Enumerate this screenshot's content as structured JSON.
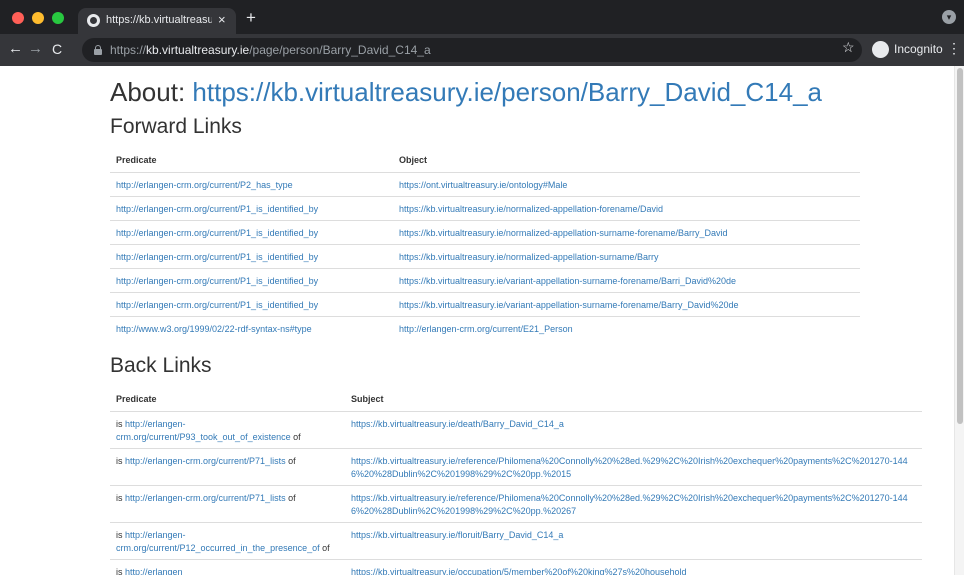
{
  "browser": {
    "tab_title": "https://kb.virtualtreasury.ie/pe",
    "tab_close": "×",
    "new_tab": "+",
    "url_prefix": "https://",
    "url_host": "kb.virtualtreasury.ie",
    "url_path": "/page/person/Barry_David_C14_a",
    "profile_label": "Incognito",
    "back_icon": "←",
    "forward_icon": "→",
    "reload_icon": "C",
    "star_icon": "☆",
    "menu_icon": "⋮"
  },
  "page": {
    "title_prefix": "About: ",
    "title_link": "https://kb.virtualtreasury.ie/person/Barry_David_C14_a",
    "forward_heading": "Forward Links",
    "forward_columns": [
      "Predicate",
      "Object"
    ],
    "forward_rows": [
      {
        "predicate": "http://erlangen-crm.org/current/P2_has_type",
        "object": "https://ont.virtualtreasury.ie/ontology#Male"
      },
      {
        "predicate": "http://erlangen-crm.org/current/P1_is_identified_by",
        "object": "https://kb.virtualtreasury.ie/normalized-appellation-forename/David"
      },
      {
        "predicate": "http://erlangen-crm.org/current/P1_is_identified_by",
        "object": "https://kb.virtualtreasury.ie/normalized-appellation-surname-forename/Barry_David"
      },
      {
        "predicate": "http://erlangen-crm.org/current/P1_is_identified_by",
        "object": "https://kb.virtualtreasury.ie/normalized-appellation-surname/Barry"
      },
      {
        "predicate": "http://erlangen-crm.org/current/P1_is_identified_by",
        "object": "https://kb.virtualtreasury.ie/variant-appellation-surname-forename/Barri_David%20de"
      },
      {
        "predicate": "http://erlangen-crm.org/current/P1_is_identified_by",
        "object": "https://kb.virtualtreasury.ie/variant-appellation-surname-forename/Barry_David%20de"
      },
      {
        "predicate": "http://www.w3.org/1999/02/22-rdf-syntax-ns#type",
        "object": "http://erlangen-crm.org/current/E21_Person"
      }
    ],
    "back_heading": "Back Links",
    "back_columns": [
      "Predicate",
      "Subject"
    ],
    "back_prefix": "is ",
    "back_suffix": " of",
    "back_rows": [
      {
        "predicate": "http://erlangen-crm.org/current/P93_took_out_of_existence",
        "subject": "https://kb.virtualtreasury.ie/death/Barry_David_C14_a"
      },
      {
        "predicate": "http://erlangen-crm.org/current/P71_lists",
        "subject": "https://kb.virtualtreasury.ie/reference/Philomena%20Connolly%20%28ed.%29%2C%20Irish%20exchequer%20payments%2C%201270-1446%20%28Dublin%2C%201998%29%2C%20pp.%2015"
      },
      {
        "predicate": "http://erlangen-crm.org/current/P71_lists",
        "subject": "https://kb.virtualtreasury.ie/reference/Philomena%20Connolly%20%28ed.%29%2C%20Irish%20exchequer%20payments%2C%201270-1446%20%28Dublin%2C%201998%29%2C%20pp.%20267"
      },
      {
        "predicate": "http://erlangen-crm.org/current/P12_occurred_in_the_presence_of",
        "subject": "https://kb.virtualtreasury.ie/floruit/Barry_David_C14_a"
      },
      {
        "predicate": "http://erlangen",
        "subject": "https://kb.virtualtreasury.ie/occupation/5/member%20of%20king%27s%20household"
      }
    ]
  }
}
